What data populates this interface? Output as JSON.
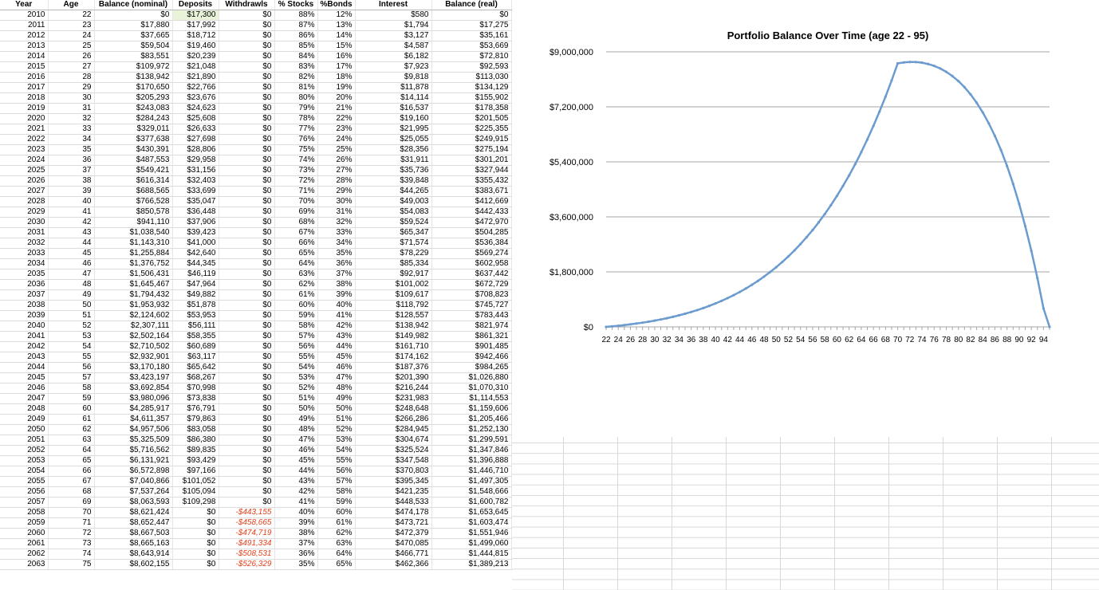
{
  "sheet": {
    "headers": [
      "Year",
      "Age",
      "Balance (nominal)",
      "Deposits",
      "Withdrawls",
      "% Stocks",
      "%Bonds",
      "Interest",
      "Balance (real)"
    ],
    "rows": [
      [
        "2010",
        "22",
        "$0",
        "$17,300",
        "$0",
        "88%",
        "12%",
        "$580",
        "$0"
      ],
      [
        "2011",
        "23",
        "$17,880",
        "$17,992",
        "$0",
        "87%",
        "13%",
        "$1,794",
        "$17,275"
      ],
      [
        "2012",
        "24",
        "$37,665",
        "$18,712",
        "$0",
        "86%",
        "14%",
        "$3,127",
        "$35,161"
      ],
      [
        "2013",
        "25",
        "$59,504",
        "$19,460",
        "$0",
        "85%",
        "15%",
        "$4,587",
        "$53,669"
      ],
      [
        "2014",
        "26",
        "$83,551",
        "$20,239",
        "$0",
        "84%",
        "16%",
        "$6,182",
        "$72,810"
      ],
      [
        "2015",
        "27",
        "$109,972",
        "$21,048",
        "$0",
        "83%",
        "17%",
        "$7,923",
        "$92,593"
      ],
      [
        "2016",
        "28",
        "$138,942",
        "$21,890",
        "$0",
        "82%",
        "18%",
        "$9,818",
        "$113,030"
      ],
      [
        "2017",
        "29",
        "$170,650",
        "$22,766",
        "$0",
        "81%",
        "19%",
        "$11,878",
        "$134,129"
      ],
      [
        "2018",
        "30",
        "$205,293",
        "$23,676",
        "$0",
        "80%",
        "20%",
        "$14,114",
        "$155,902"
      ],
      [
        "2019",
        "31",
        "$243,083",
        "$24,623",
        "$0",
        "79%",
        "21%",
        "$16,537",
        "$178,358"
      ],
      [
        "2020",
        "32",
        "$284,243",
        "$25,608",
        "$0",
        "78%",
        "22%",
        "$19,160",
        "$201,505"
      ],
      [
        "2021",
        "33",
        "$329,011",
        "$26,633",
        "$0",
        "77%",
        "23%",
        "$21,995",
        "$225,355"
      ],
      [
        "2022",
        "34",
        "$377,638",
        "$27,698",
        "$0",
        "76%",
        "24%",
        "$25,055",
        "$249,915"
      ],
      [
        "2023",
        "35",
        "$430,391",
        "$28,806",
        "$0",
        "75%",
        "25%",
        "$28,356",
        "$275,194"
      ],
      [
        "2024",
        "36",
        "$487,553",
        "$29,958",
        "$0",
        "74%",
        "26%",
        "$31,911",
        "$301,201"
      ],
      [
        "2025",
        "37",
        "$549,421",
        "$31,156",
        "$0",
        "73%",
        "27%",
        "$35,736",
        "$327,944"
      ],
      [
        "2026",
        "38",
        "$616,314",
        "$32,403",
        "$0",
        "72%",
        "28%",
        "$39,848",
        "$355,432"
      ],
      [
        "2027",
        "39",
        "$688,565",
        "$33,699",
        "$0",
        "71%",
        "29%",
        "$44,265",
        "$383,671"
      ],
      [
        "2028",
        "40",
        "$766,528",
        "$35,047",
        "$0",
        "70%",
        "30%",
        "$49,003",
        "$412,669"
      ],
      [
        "2029",
        "41",
        "$850,578",
        "$36,448",
        "$0",
        "69%",
        "31%",
        "$54,083",
        "$442,433"
      ],
      [
        "2030",
        "42",
        "$941,110",
        "$37,906",
        "$0",
        "68%",
        "32%",
        "$59,524",
        "$472,970"
      ],
      [
        "2031",
        "43",
        "$1,038,540",
        "$39,423",
        "$0",
        "67%",
        "33%",
        "$65,347",
        "$504,285"
      ],
      [
        "2032",
        "44",
        "$1,143,310",
        "$41,000",
        "$0",
        "66%",
        "34%",
        "$71,574",
        "$536,384"
      ],
      [
        "2033",
        "45",
        "$1,255,884",
        "$42,640",
        "$0",
        "65%",
        "35%",
        "$78,229",
        "$569,274"
      ],
      [
        "2034",
        "46",
        "$1,376,752",
        "$44,345",
        "$0",
        "64%",
        "36%",
        "$85,334",
        "$602,958"
      ],
      [
        "2035",
        "47",
        "$1,506,431",
        "$46,119",
        "$0",
        "63%",
        "37%",
        "$92,917",
        "$637,442"
      ],
      [
        "2036",
        "48",
        "$1,645,467",
        "$47,964",
        "$0",
        "62%",
        "38%",
        "$101,002",
        "$672,729"
      ],
      [
        "2037",
        "49",
        "$1,794,432",
        "$49,882",
        "$0",
        "61%",
        "39%",
        "$109,617",
        "$708,823"
      ],
      [
        "2038",
        "50",
        "$1,953,932",
        "$51,878",
        "$0",
        "60%",
        "40%",
        "$118,792",
        "$745,727"
      ],
      [
        "2039",
        "51",
        "$2,124,602",
        "$53,953",
        "$0",
        "59%",
        "41%",
        "$128,557",
        "$783,443"
      ],
      [
        "2040",
        "52",
        "$2,307,111",
        "$56,111",
        "$0",
        "58%",
        "42%",
        "$138,942",
        "$821,974"
      ],
      [
        "2041",
        "53",
        "$2,502,164",
        "$58,355",
        "$0",
        "57%",
        "43%",
        "$149,982",
        "$861,321"
      ],
      [
        "2042",
        "54",
        "$2,710,502",
        "$60,689",
        "$0",
        "56%",
        "44%",
        "$161,710",
        "$901,485"
      ],
      [
        "2043",
        "55",
        "$2,932,901",
        "$63,117",
        "$0",
        "55%",
        "45%",
        "$174,162",
        "$942,466"
      ],
      [
        "2044",
        "56",
        "$3,170,180",
        "$65,642",
        "$0",
        "54%",
        "46%",
        "$187,376",
        "$984,265"
      ],
      [
        "2045",
        "57",
        "$3,423,197",
        "$68,267",
        "$0",
        "53%",
        "47%",
        "$201,390",
        "$1,026,880"
      ],
      [
        "2046",
        "58",
        "$3,692,854",
        "$70,998",
        "$0",
        "52%",
        "48%",
        "$216,244",
        "$1,070,310"
      ],
      [
        "2047",
        "59",
        "$3,980,096",
        "$73,838",
        "$0",
        "51%",
        "49%",
        "$231,983",
        "$1,114,553"
      ],
      [
        "2048",
        "60",
        "$4,285,917",
        "$76,791",
        "$0",
        "50%",
        "50%",
        "$248,648",
        "$1,159,606"
      ],
      [
        "2049",
        "61",
        "$4,611,357",
        "$79,863",
        "$0",
        "49%",
        "51%",
        "$266,286",
        "$1,205,466"
      ],
      [
        "2050",
        "62",
        "$4,957,506",
        "$83,058",
        "$0",
        "48%",
        "52%",
        "$284,945",
        "$1,252,130"
      ],
      [
        "2051",
        "63",
        "$5,325,509",
        "$86,380",
        "$0",
        "47%",
        "53%",
        "$304,674",
        "$1,299,591"
      ],
      [
        "2052",
        "64",
        "$5,716,562",
        "$89,835",
        "$0",
        "46%",
        "54%",
        "$325,524",
        "$1,347,846"
      ],
      [
        "2053",
        "65",
        "$6,131,921",
        "$93,429",
        "$0",
        "45%",
        "55%",
        "$347,548",
        "$1,396,888"
      ],
      [
        "2054",
        "66",
        "$6,572,898",
        "$97,166",
        "$0",
        "44%",
        "56%",
        "$370,803",
        "$1,446,710"
      ],
      [
        "2055",
        "67",
        "$7,040,866",
        "$101,052",
        "$0",
        "43%",
        "57%",
        "$395,345",
        "$1,497,305"
      ],
      [
        "2056",
        "68",
        "$7,537,264",
        "$105,094",
        "$0",
        "42%",
        "58%",
        "$421,235",
        "$1,548,666"
      ],
      [
        "2057",
        "69",
        "$8,063,593",
        "$109,298",
        "$0",
        "41%",
        "59%",
        "$448,533",
        "$1,600,782"
      ],
      [
        "2058",
        "70",
        "$8,621,424",
        "$0",
        "-$443,155",
        "40%",
        "60%",
        "$474,178",
        "$1,653,645"
      ],
      [
        "2059",
        "71",
        "$8,652,447",
        "$0",
        "-$458,665",
        "39%",
        "61%",
        "$473,721",
        "$1,603,474"
      ],
      [
        "2060",
        "72",
        "$8,667,503",
        "$0",
        "-$474,719",
        "38%",
        "62%",
        "$472,379",
        "$1,551,946"
      ],
      [
        "2061",
        "73",
        "$8,665,163",
        "$0",
        "-$491,334",
        "37%",
        "63%",
        "$470,085",
        "$1,499,060"
      ],
      [
        "2062",
        "74",
        "$8,643,914",
        "$0",
        "-$508,531",
        "36%",
        "64%",
        "$466,771",
        "$1,444,815"
      ],
      [
        "2063",
        "75",
        "$8,602,155",
        "$0",
        "-$526,329",
        "35%",
        "65%",
        "$462,366",
        "$1,389,213"
      ]
    ]
  },
  "chart_data": {
    "type": "line",
    "title": "Portfolio Balance Over Time (age 22 - 95)",
    "xlabel": "",
    "ylabel": "",
    "ylim": [
      0,
      9000000
    ],
    "y_ticks": [
      "$0",
      "$1,800,000",
      "$3,600,000",
      "$5,400,000",
      "$7,200,000",
      "$9,000,000"
    ],
    "x": [
      22,
      23,
      24,
      25,
      26,
      27,
      28,
      29,
      30,
      31,
      32,
      33,
      34,
      35,
      36,
      37,
      38,
      39,
      40,
      41,
      42,
      43,
      44,
      45,
      46,
      47,
      48,
      49,
      50,
      51,
      52,
      53,
      54,
      55,
      56,
      57,
      58,
      59,
      60,
      61,
      62,
      63,
      64,
      65,
      66,
      67,
      68,
      69,
      70,
      71,
      72,
      73,
      74,
      75,
      76,
      77,
      78,
      79,
      80,
      81,
      82,
      83,
      84,
      85,
      86,
      87,
      88,
      89,
      90,
      91,
      92,
      93,
      94,
      95
    ],
    "x_tick_labels": [
      "22",
      "24",
      "26",
      "28",
      "30",
      "32",
      "34",
      "36",
      "38",
      "40",
      "42",
      "44",
      "46",
      "48",
      "50",
      "52",
      "54",
      "56",
      "58",
      "60",
      "62",
      "64",
      "66",
      "68",
      "70",
      "72",
      "74",
      "76",
      "78",
      "80",
      "82",
      "84",
      "86",
      "88",
      "90",
      "92",
      "94"
    ],
    "grid": true,
    "legend": "none",
    "line_color": "#6b9bcf",
    "series": [
      {
        "values": [
          0,
          17880,
          37665,
          59504,
          83551,
          109972,
          138942,
          170650,
          205293,
          243083,
          284243,
          329011,
          377638,
          430391,
          487553,
          549421,
          616314,
          688565,
          766528,
          850578,
          941110,
          1038540,
          1143310,
          1255884,
          1376752,
          1506431,
          1645467,
          1794432,
          1953932,
          2124602,
          2307111,
          2502164,
          2710502,
          2932901,
          3170180,
          3423197,
          3692854,
          3980096,
          4285917,
          4611357,
          4957506,
          5325509,
          5716562,
          6131921,
          6572898,
          7040866,
          7537264,
          8063593,
          8621424,
          8652447,
          8667503,
          8665163,
          8643914,
          8602155,
          8540000,
          8455000,
          8345000,
          8208000,
          8041000,
          7842000,
          7607000,
          7334000,
          7019000,
          6659000,
          6249000,
          5786000,
          5264000,
          4679000,
          4025000,
          3297000,
          2488000,
          1593000,
          604000,
          0
        ]
      }
    ]
  }
}
